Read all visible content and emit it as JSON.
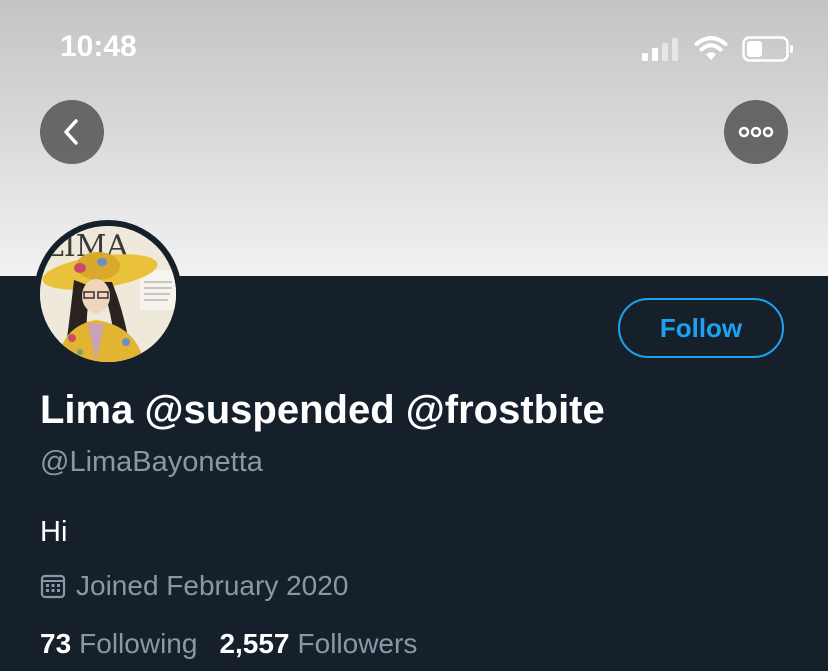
{
  "status_bar": {
    "time": "10:48",
    "icons": [
      "cellular-signal-icon",
      "wifi-icon",
      "battery-icon"
    ]
  },
  "nav": {
    "back_icon": "chevron-left-icon",
    "more_icon": "more-horizontal-icon"
  },
  "profile": {
    "display_name": "Lima @suspended @frostbite",
    "handle": "@LimaBayonetta",
    "bio": "Hi",
    "joined": "Joined February 2020",
    "follow_label": "Follow",
    "following_count": "73",
    "following_label": "Following",
    "followers_count": "2,557",
    "followers_label": "Followers",
    "avatar_text": "LIMA"
  },
  "colors": {
    "background": "#15202b",
    "accent": "#1da1f2",
    "secondary_text": "#8899a6",
    "primary_text": "#ffffff"
  }
}
